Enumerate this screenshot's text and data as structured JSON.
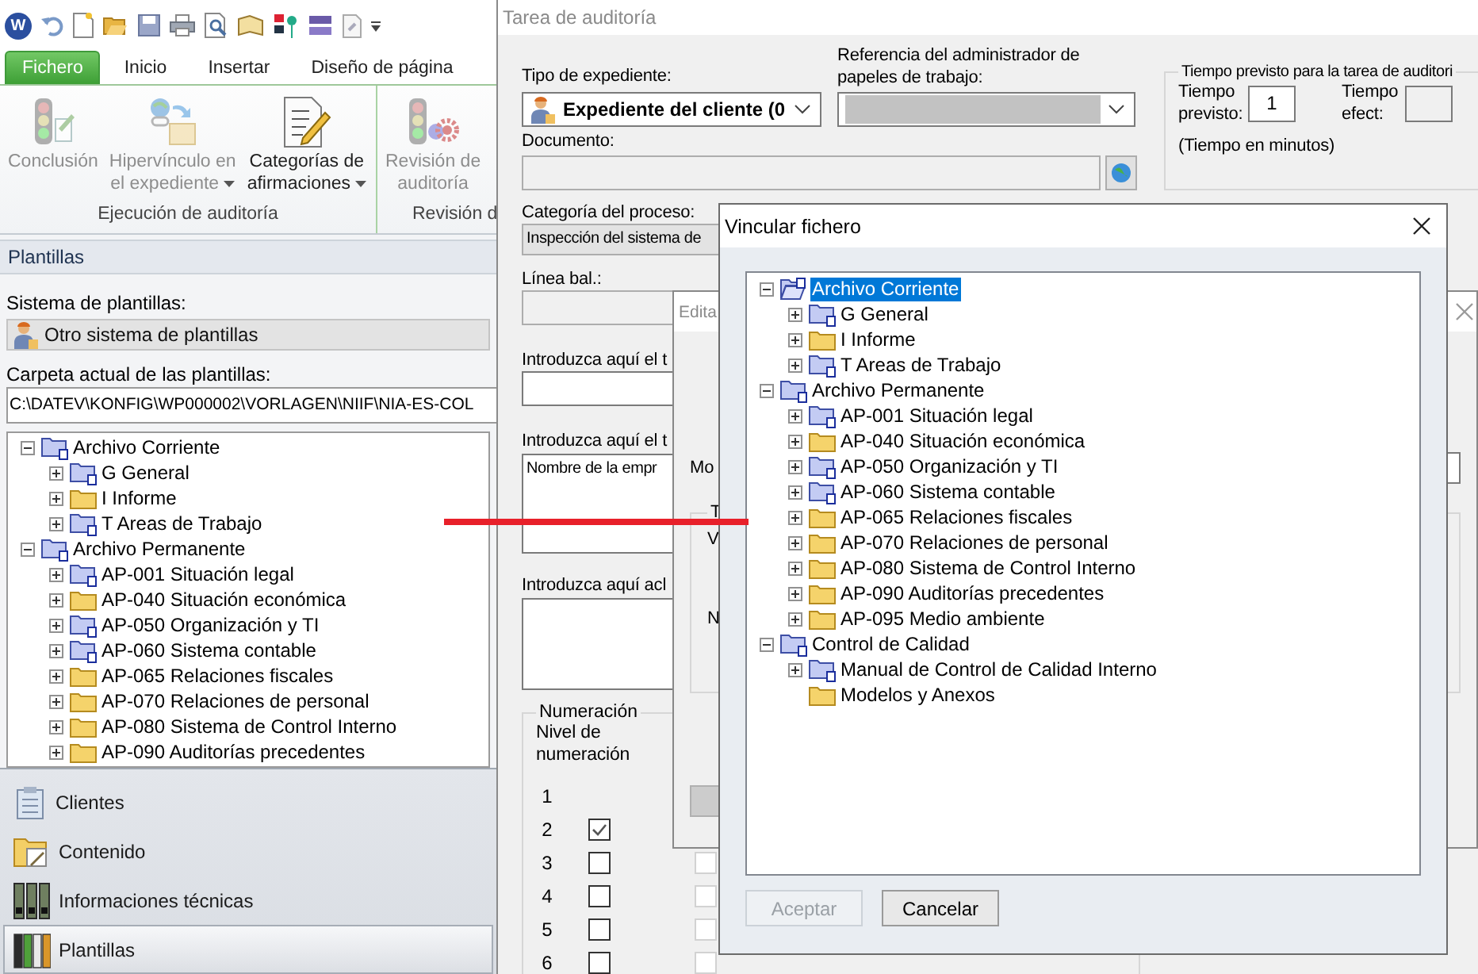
{
  "app_logo": "W",
  "ribbon": {
    "tabs": [
      {
        "label": "Fichero",
        "selected": true
      },
      {
        "label": "Inicio",
        "selected": false
      },
      {
        "label": "Insertar",
        "selected": false
      },
      {
        "label": "Diseño de página",
        "selected": false
      }
    ],
    "groups": [
      {
        "label": "Ejecución de auditoría",
        "buttons": [
          {
            "kind": "traffic",
            "lines": [
              "Conclusión"
            ],
            "disabled": true,
            "dropdown": false
          },
          {
            "kind": "link",
            "lines": [
              "Hipervínculo en",
              "el expediente"
            ],
            "disabled": true,
            "dropdown": true
          },
          {
            "kind": "document",
            "lines": [
              "Categorías de",
              "afirmaciones"
            ],
            "disabled": false,
            "dropdown": true
          }
        ]
      },
      {
        "label": "Revisión d",
        "buttons": [
          {
            "kind": "review",
            "lines": [
              "Revisión de",
              "auditoría"
            ],
            "disabled": true,
            "dropdown": false
          }
        ]
      }
    ]
  },
  "templates_panel": {
    "title": "Plantillas",
    "system_label": "Sistema de plantillas:",
    "system_button": "Otro sistema de plantillas",
    "folder_label": "Carpeta actual de las plantillas:",
    "folder_path": "C:\\DATEV\\KONFIG\\WP000002\\VORLAGEN\\NIIF\\NIA-ES-COL",
    "tree": [
      {
        "label": "Archivo Corriente",
        "kind": "linked",
        "expanded": true,
        "children": [
          {
            "label": "G General",
            "kind": "linked",
            "expanded": false
          },
          {
            "label": "I Informe",
            "kind": "plain",
            "expanded": false
          },
          {
            "label": "T Areas de Trabajo",
            "kind": "linked",
            "expanded": false
          }
        ]
      },
      {
        "label": "Archivo Permanente",
        "kind": "linked",
        "expanded": true,
        "children": [
          {
            "label": "AP-001 Situación legal",
            "kind": "linked",
            "expanded": false
          },
          {
            "label": "AP-040 Situación económica",
            "kind": "plain",
            "expanded": false
          },
          {
            "label": "AP-050 Organización y TI",
            "kind": "linked",
            "expanded": false
          },
          {
            "label": "AP-060 Sistema contable",
            "kind": "linked",
            "expanded": false
          },
          {
            "label": "AP-065 Relaciones fiscales",
            "kind": "plain",
            "expanded": false
          },
          {
            "label": "AP-070 Relaciones de personal",
            "kind": "plain",
            "expanded": false
          },
          {
            "label": "AP-080 Sistema de Control Interno",
            "kind": "plain",
            "expanded": false
          },
          {
            "label": "AP-090 Auditorías precedentes",
            "kind": "plain",
            "expanded": false
          }
        ]
      }
    ]
  },
  "nav": [
    {
      "kind": "clients",
      "label": "Clientes",
      "selected": false
    },
    {
      "kind": "content",
      "label": "Contenido",
      "selected": false
    },
    {
      "kind": "technical",
      "label": "Informaciones técnicas",
      "selected": false
    },
    {
      "kind": "templates",
      "label": "Plantillas",
      "selected": true
    }
  ],
  "audit_task": {
    "title": "Tarea de auditoría",
    "file_type": {
      "label": "Tipo de expediente:",
      "value": "Expediente del cliente (0"
    },
    "reference": {
      "label": "Referencia del administrador de papeles de trabajo:"
    },
    "time": {
      "title": "Tiempo previsto para la tarea de auditori",
      "planned_label": "Tiempo previsto:",
      "planned_value": "1",
      "actual_label": "Tiempo efect:",
      "note": "(Tiempo en minutos)"
    },
    "document": {
      "label": "Documento:"
    },
    "category": {
      "label": "Categoría del proceso:",
      "value": "Inspección del sistema de"
    },
    "balance_line": {
      "label": "Línea bal.:"
    },
    "text_fields": [
      {
        "label": "Introduzca aquí el t",
        "kind": "single"
      },
      {
        "label": "Introduzca aquí el t",
        "kind": "multi",
        "value": "Nombre de la empr"
      },
      {
        "label": "Introduzca aquí acl",
        "kind": "multi_short"
      }
    ],
    "numbering": {
      "title": "Numeración",
      "level_label": "Nivel de numeración",
      "levels": [
        {
          "number": "1",
          "kind": "plain"
        },
        {
          "number": "2",
          "kind": "checkbox",
          "checked": true
        },
        {
          "number": "3",
          "kind": "checkbox",
          "checked": false,
          "option_checked": false
        },
        {
          "number": "4",
          "kind": "checkbox",
          "checked": false,
          "option_checked": false
        },
        {
          "number": "5",
          "kind": "checkbox",
          "checked": false,
          "option_checked": false
        },
        {
          "number": "6",
          "kind": "checkbox",
          "checked": false,
          "option_checked": false
        }
      ]
    }
  },
  "edit_window": {
    "title": "Edita",
    "labels": [
      "Mo",
      "T",
      "V",
      "N"
    ]
  },
  "link_dialog": {
    "title": "Vincular fichero",
    "tree": [
      {
        "label": "Archivo Corriente",
        "kind": "open",
        "expanded": true,
        "selected": true,
        "children": [
          {
            "label": "G General",
            "kind": "linked",
            "expanded": false,
            "selected": false
          },
          {
            "label": "I Informe",
            "kind": "plain",
            "expanded": false,
            "selected": false
          },
          {
            "label": "T Areas de Trabajo",
            "kind": "linked",
            "expanded": false,
            "selected": false
          }
        ]
      },
      {
        "label": "Archivo Permanente",
        "kind": "linked",
        "expanded": true,
        "selected": false,
        "children": [
          {
            "label": "AP-001 Situación legal",
            "kind": "linked",
            "expanded": false,
            "selected": false
          },
          {
            "label": "AP-040 Situación económica",
            "kind": "plain",
            "expanded": false,
            "selected": false
          },
          {
            "label": "AP-050 Organización y TI",
            "kind": "linked",
            "expanded": false,
            "selected": false
          },
          {
            "label": "AP-060 Sistema contable",
            "kind": "linked",
            "expanded": false,
            "selected": false
          },
          {
            "label": "AP-065 Relaciones fiscales",
            "kind": "plain",
            "expanded": false,
            "selected": false
          },
          {
            "label": "AP-070 Relaciones de personal",
            "kind": "plain",
            "expanded": false,
            "selected": false
          },
          {
            "label": "AP-080 Sistema de Control Interno",
            "kind": "plain",
            "expanded": false,
            "selected": false
          },
          {
            "label": "AP-090 Auditorías precedentes",
            "kind": "plain",
            "expanded": false,
            "selected": false
          },
          {
            "label": "AP-095 Medio ambiente",
            "kind": "plain",
            "expanded": false,
            "selected": false
          }
        ]
      },
      {
        "label": "Control de Calidad",
        "kind": "linked",
        "expanded": true,
        "selected": false,
        "children": [
          {
            "label": "Manual de Control de Calidad Interno",
            "kind": "linked",
            "expanded": false,
            "selected": false
          },
          {
            "label": "Modelos y Anexos",
            "kind": "plain",
            "selected": false
          }
        ]
      }
    ],
    "buttons": [
      {
        "label": "Aceptar",
        "disabled": true
      },
      {
        "label": "Cancelar",
        "disabled": false
      }
    ]
  }
}
